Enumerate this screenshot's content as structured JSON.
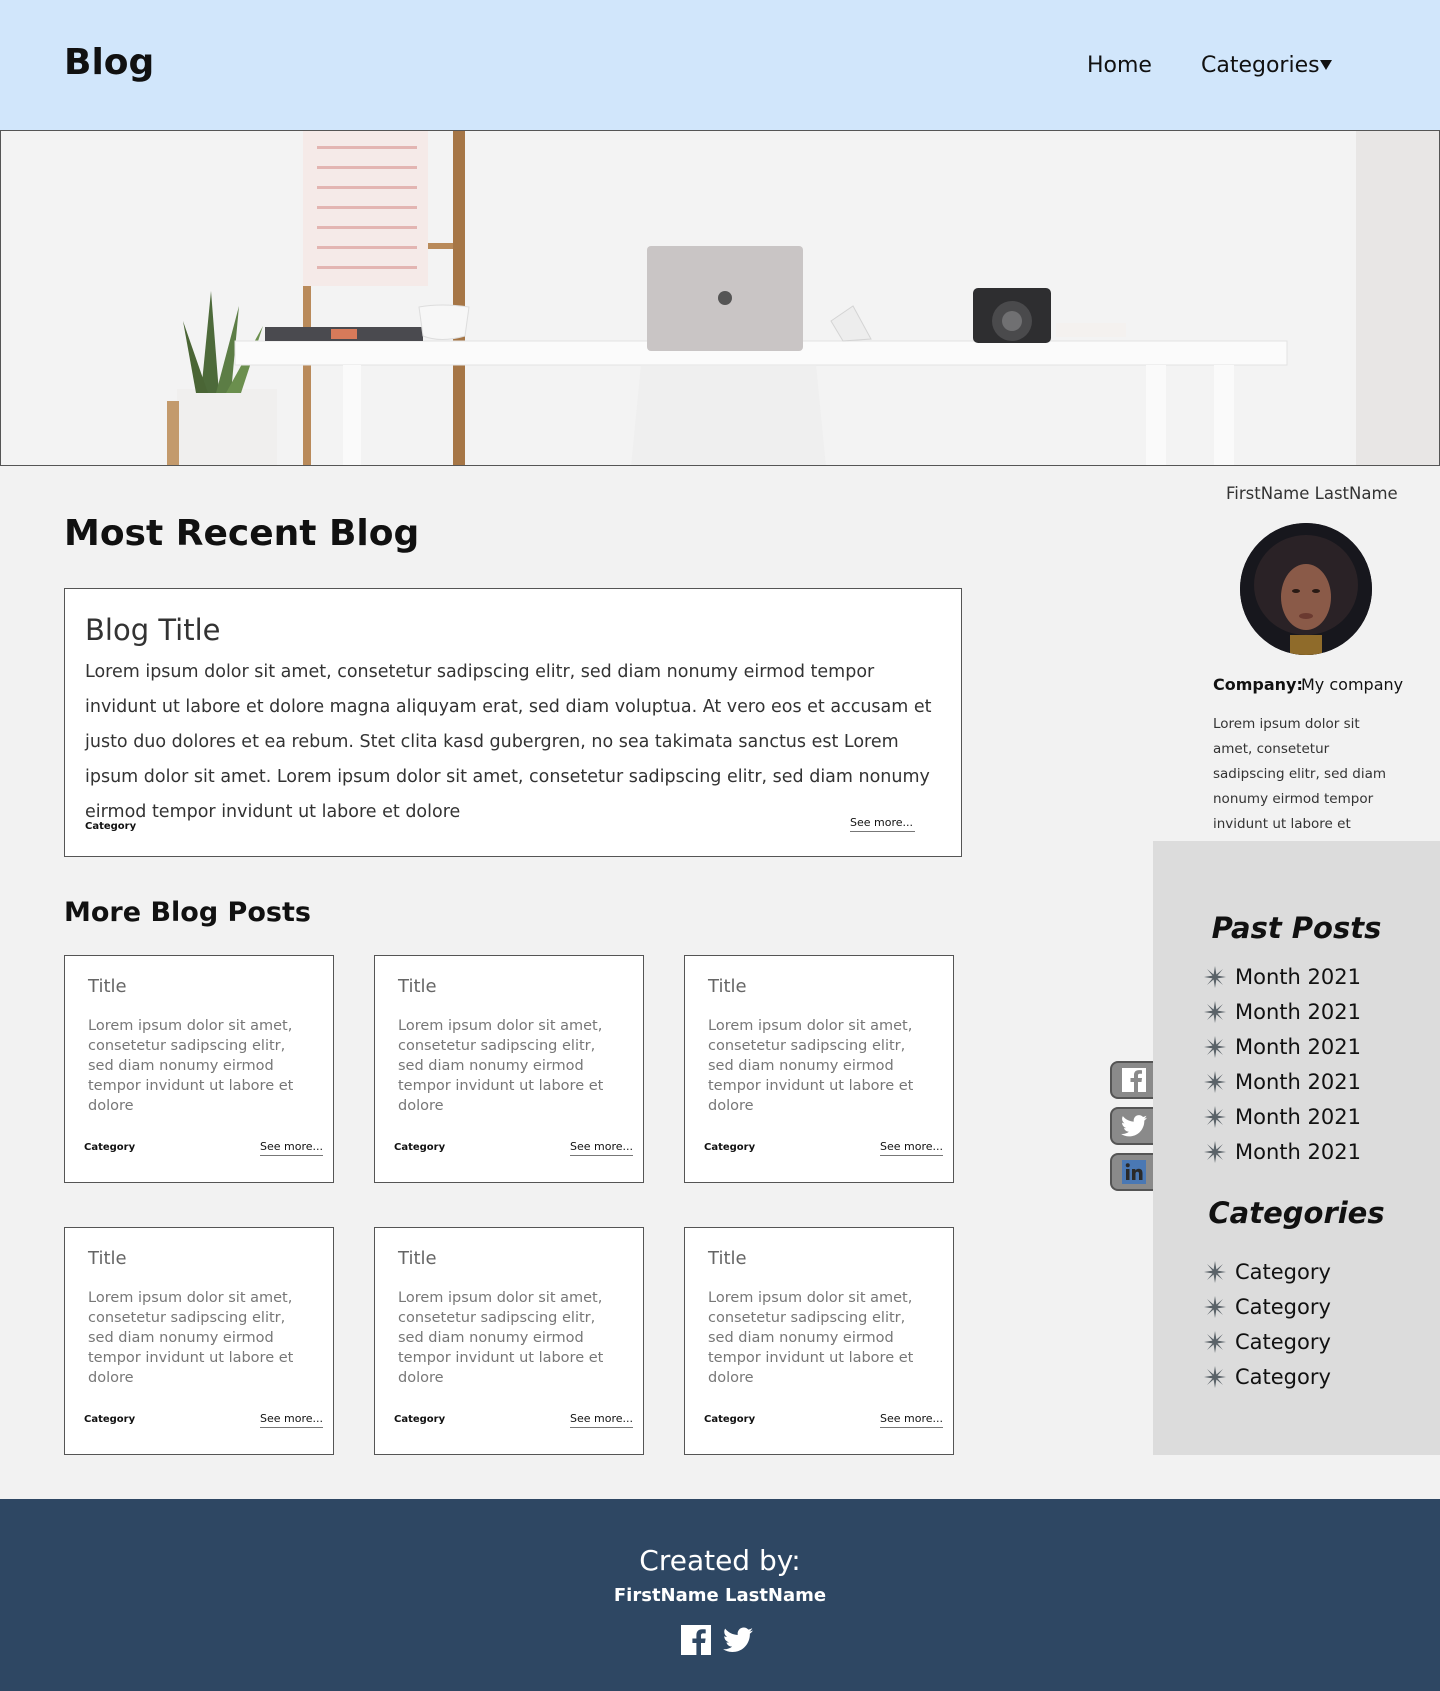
{
  "header": {
    "logo": "Blog",
    "nav": {
      "home": "Home",
      "categories": "Categories"
    }
  },
  "recent": {
    "heading": "Most Recent Blog",
    "title": "Blog Title",
    "body": "Lorem ipsum dolor sit amet, consetetur sadipscing elitr, sed diam nonumy eirmod tempor invidunt ut labore et dolore magna aliquyam erat, sed diam voluptua. At vero eos et accusam et justo duo dolores et ea rebum. Stet clita kasd gubergren, no sea takimata sanctus est Lorem ipsum dolor sit amet. Lorem ipsum dolor sit amet, consetetur sadipscing elitr, sed diam nonumy eirmod tempor invidunt ut labore et dolore",
    "category": "Category",
    "more": "See more..."
  },
  "more_posts": {
    "heading": "More Blog Posts",
    "posts": [
      {
        "title": "Title",
        "body": "Lorem ipsum dolor sit amet, consetetur sadipscing elitr, sed diam nonumy eirmod tempor invidunt ut labore et dolore",
        "category": "Category",
        "more": "See more..."
      },
      {
        "title": "Title",
        "body": "Lorem ipsum dolor sit amet, consetetur sadipscing elitr, sed diam nonumy eirmod tempor invidunt ut labore et dolore",
        "category": "Category",
        "more": "See more..."
      },
      {
        "title": "Title",
        "body": "Lorem ipsum dolor sit amet, consetetur sadipscing elitr, sed diam nonumy eirmod tempor invidunt ut labore et dolore",
        "category": "Category",
        "more": "See more..."
      },
      {
        "title": "Title",
        "body": "Lorem ipsum dolor sit amet, consetetur sadipscing elitr, sed diam nonumy eirmod tempor invidunt ut labore et dolore",
        "category": "Category",
        "more": "See more..."
      },
      {
        "title": "Title",
        "body": "Lorem ipsum dolor sit amet, consetetur sadipscing elitr, sed diam nonumy eirmod tempor invidunt ut labore et dolore",
        "category": "Category",
        "more": "See more..."
      },
      {
        "title": "Title",
        "body": "Lorem ipsum dolor sit amet, consetetur sadipscing elitr, sed diam nonumy eirmod tempor invidunt ut labore et dolore",
        "category": "Category",
        "more": "See more..."
      }
    ]
  },
  "profile": {
    "name": "FirstName LastName",
    "company_label": "Company:",
    "company_value": "My company",
    "bio": "Lorem ipsum dolor sit amet, consetetur sadipscing elitr, sed diam nonumy eirmod tempor invidunt ut labore et"
  },
  "sidebar": {
    "past_heading": "Past Posts",
    "months": [
      "Month 2021",
      "Month 2021",
      "Month 2021",
      "Month 2021",
      "Month 2021",
      "Month 2021"
    ],
    "categories_heading": "Categories",
    "categories": [
      "Category",
      "Category",
      "Category",
      "Category"
    ]
  },
  "social": {
    "icons": [
      "facebook-icon",
      "twitter-icon",
      "linkedin-icon"
    ]
  },
  "footer": {
    "created": "Created by:",
    "name": "FirstName LastName",
    "icons": [
      "facebook-icon",
      "twitter-icon"
    ]
  },
  "colors": {
    "header_bg": "#d1e6fb",
    "page_bg": "#f2f2f2",
    "sidebar_bg": "#dcdcdc",
    "footer_bg": "#2e4763"
  }
}
